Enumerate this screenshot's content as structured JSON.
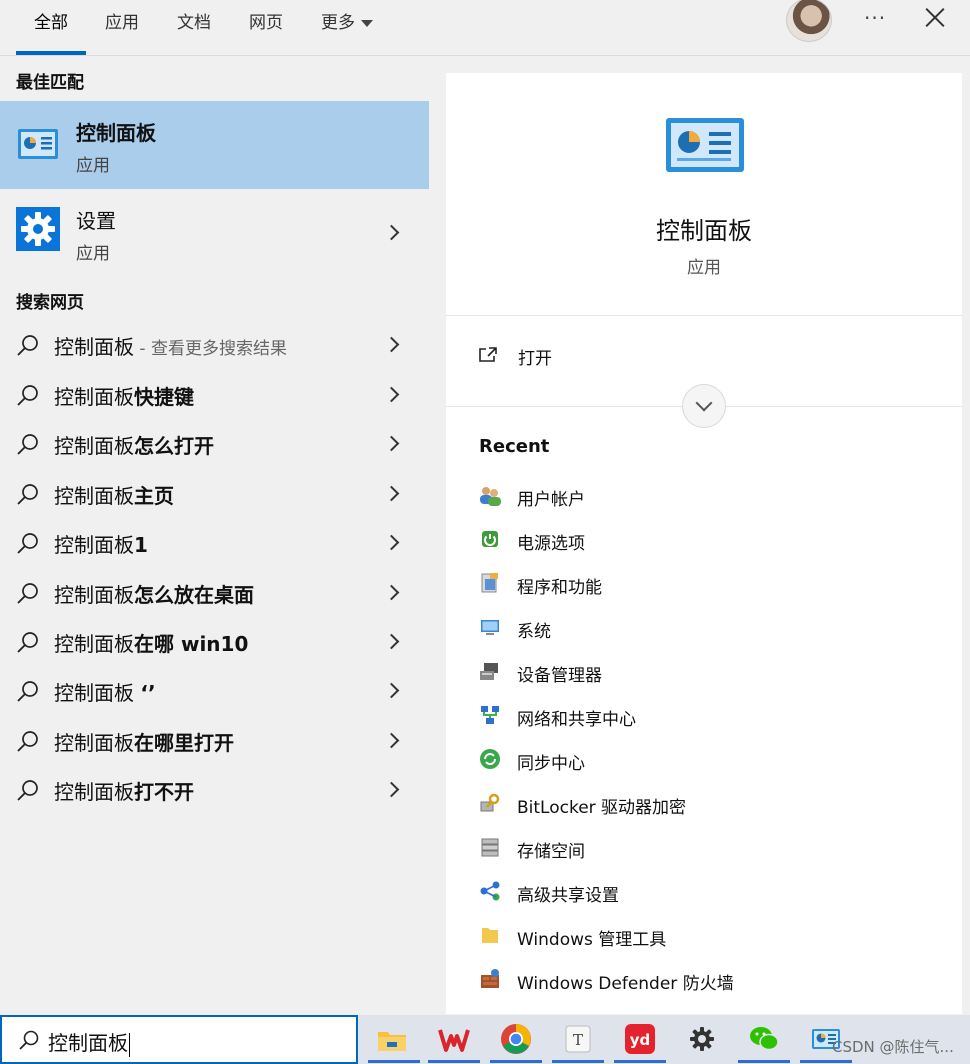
{
  "tabs": [
    {
      "label": "全部"
    },
    {
      "label": "应用"
    },
    {
      "label": "文档"
    },
    {
      "label": "网页"
    },
    {
      "label": "更多"
    }
  ],
  "top_actions": {
    "more_dots": "···"
  },
  "best_match": {
    "heading": "最佳匹配",
    "title": "控制面板",
    "subtitle": "应用"
  },
  "settings_app": {
    "title": "设置",
    "subtitle": "应用"
  },
  "web_search": {
    "heading": "搜索网页",
    "items": [
      {
        "prefix": "控制面板",
        "bold": "",
        "muted": " - 查看更多搜索结果"
      },
      {
        "prefix": "控制面板",
        "bold": "快捷键",
        "muted": ""
      },
      {
        "prefix": "控制面板",
        "bold": "怎么打开",
        "muted": ""
      },
      {
        "prefix": "控制面板",
        "bold": "主页",
        "muted": ""
      },
      {
        "prefix": "控制面板",
        "bold": "1",
        "muted": ""
      },
      {
        "prefix": "控制面板",
        "bold": "怎么放在桌面",
        "muted": ""
      },
      {
        "prefix": "控制面板",
        "bold": "在哪 win10",
        "muted": ""
      },
      {
        "prefix": "控制面板 ",
        "bold": "‘’",
        "muted": ""
      },
      {
        "prefix": "控制面板",
        "bold": "在哪里打开",
        "muted": ""
      },
      {
        "prefix": "控制面板",
        "bold": "打不开",
        "muted": ""
      }
    ]
  },
  "detail": {
    "title": "控制面板",
    "subtitle": "应用",
    "open_label": "打开",
    "recent_heading": "Recent",
    "recent_items": [
      {
        "label": "用户帐户",
        "icon": "users-icon"
      },
      {
        "label": "电源选项",
        "icon": "power-options-icon"
      },
      {
        "label": "程序和功能",
        "icon": "programs-icon"
      },
      {
        "label": "系统",
        "icon": "system-icon"
      },
      {
        "label": "设备管理器",
        "icon": "device-manager-icon"
      },
      {
        "label": "网络和共享中心",
        "icon": "network-icon"
      },
      {
        "label": "同步中心",
        "icon": "sync-center-icon"
      },
      {
        "label": "BitLocker 驱动器加密",
        "icon": "bitlocker-icon"
      },
      {
        "label": "存储空间",
        "icon": "storage-spaces-icon"
      },
      {
        "label": "高级共享设置",
        "icon": "sharing-icon"
      },
      {
        "label": "Windows 管理工具",
        "icon": "admin-tools-icon"
      },
      {
        "label": "Windows Defender 防火墙",
        "icon": "firewall-icon"
      }
    ]
  },
  "search_box": {
    "value": "控制面板"
  },
  "taskbar": {
    "apps": [
      "file-explorer-icon",
      "wps-icon",
      "chrome-icon",
      "typora-icon",
      "youdao-icon",
      "settings-icon",
      "wechat-icon",
      "control-panel-icon"
    ],
    "youdao_text": "yd"
  },
  "watermark": "CSDN @陈住气..."
}
